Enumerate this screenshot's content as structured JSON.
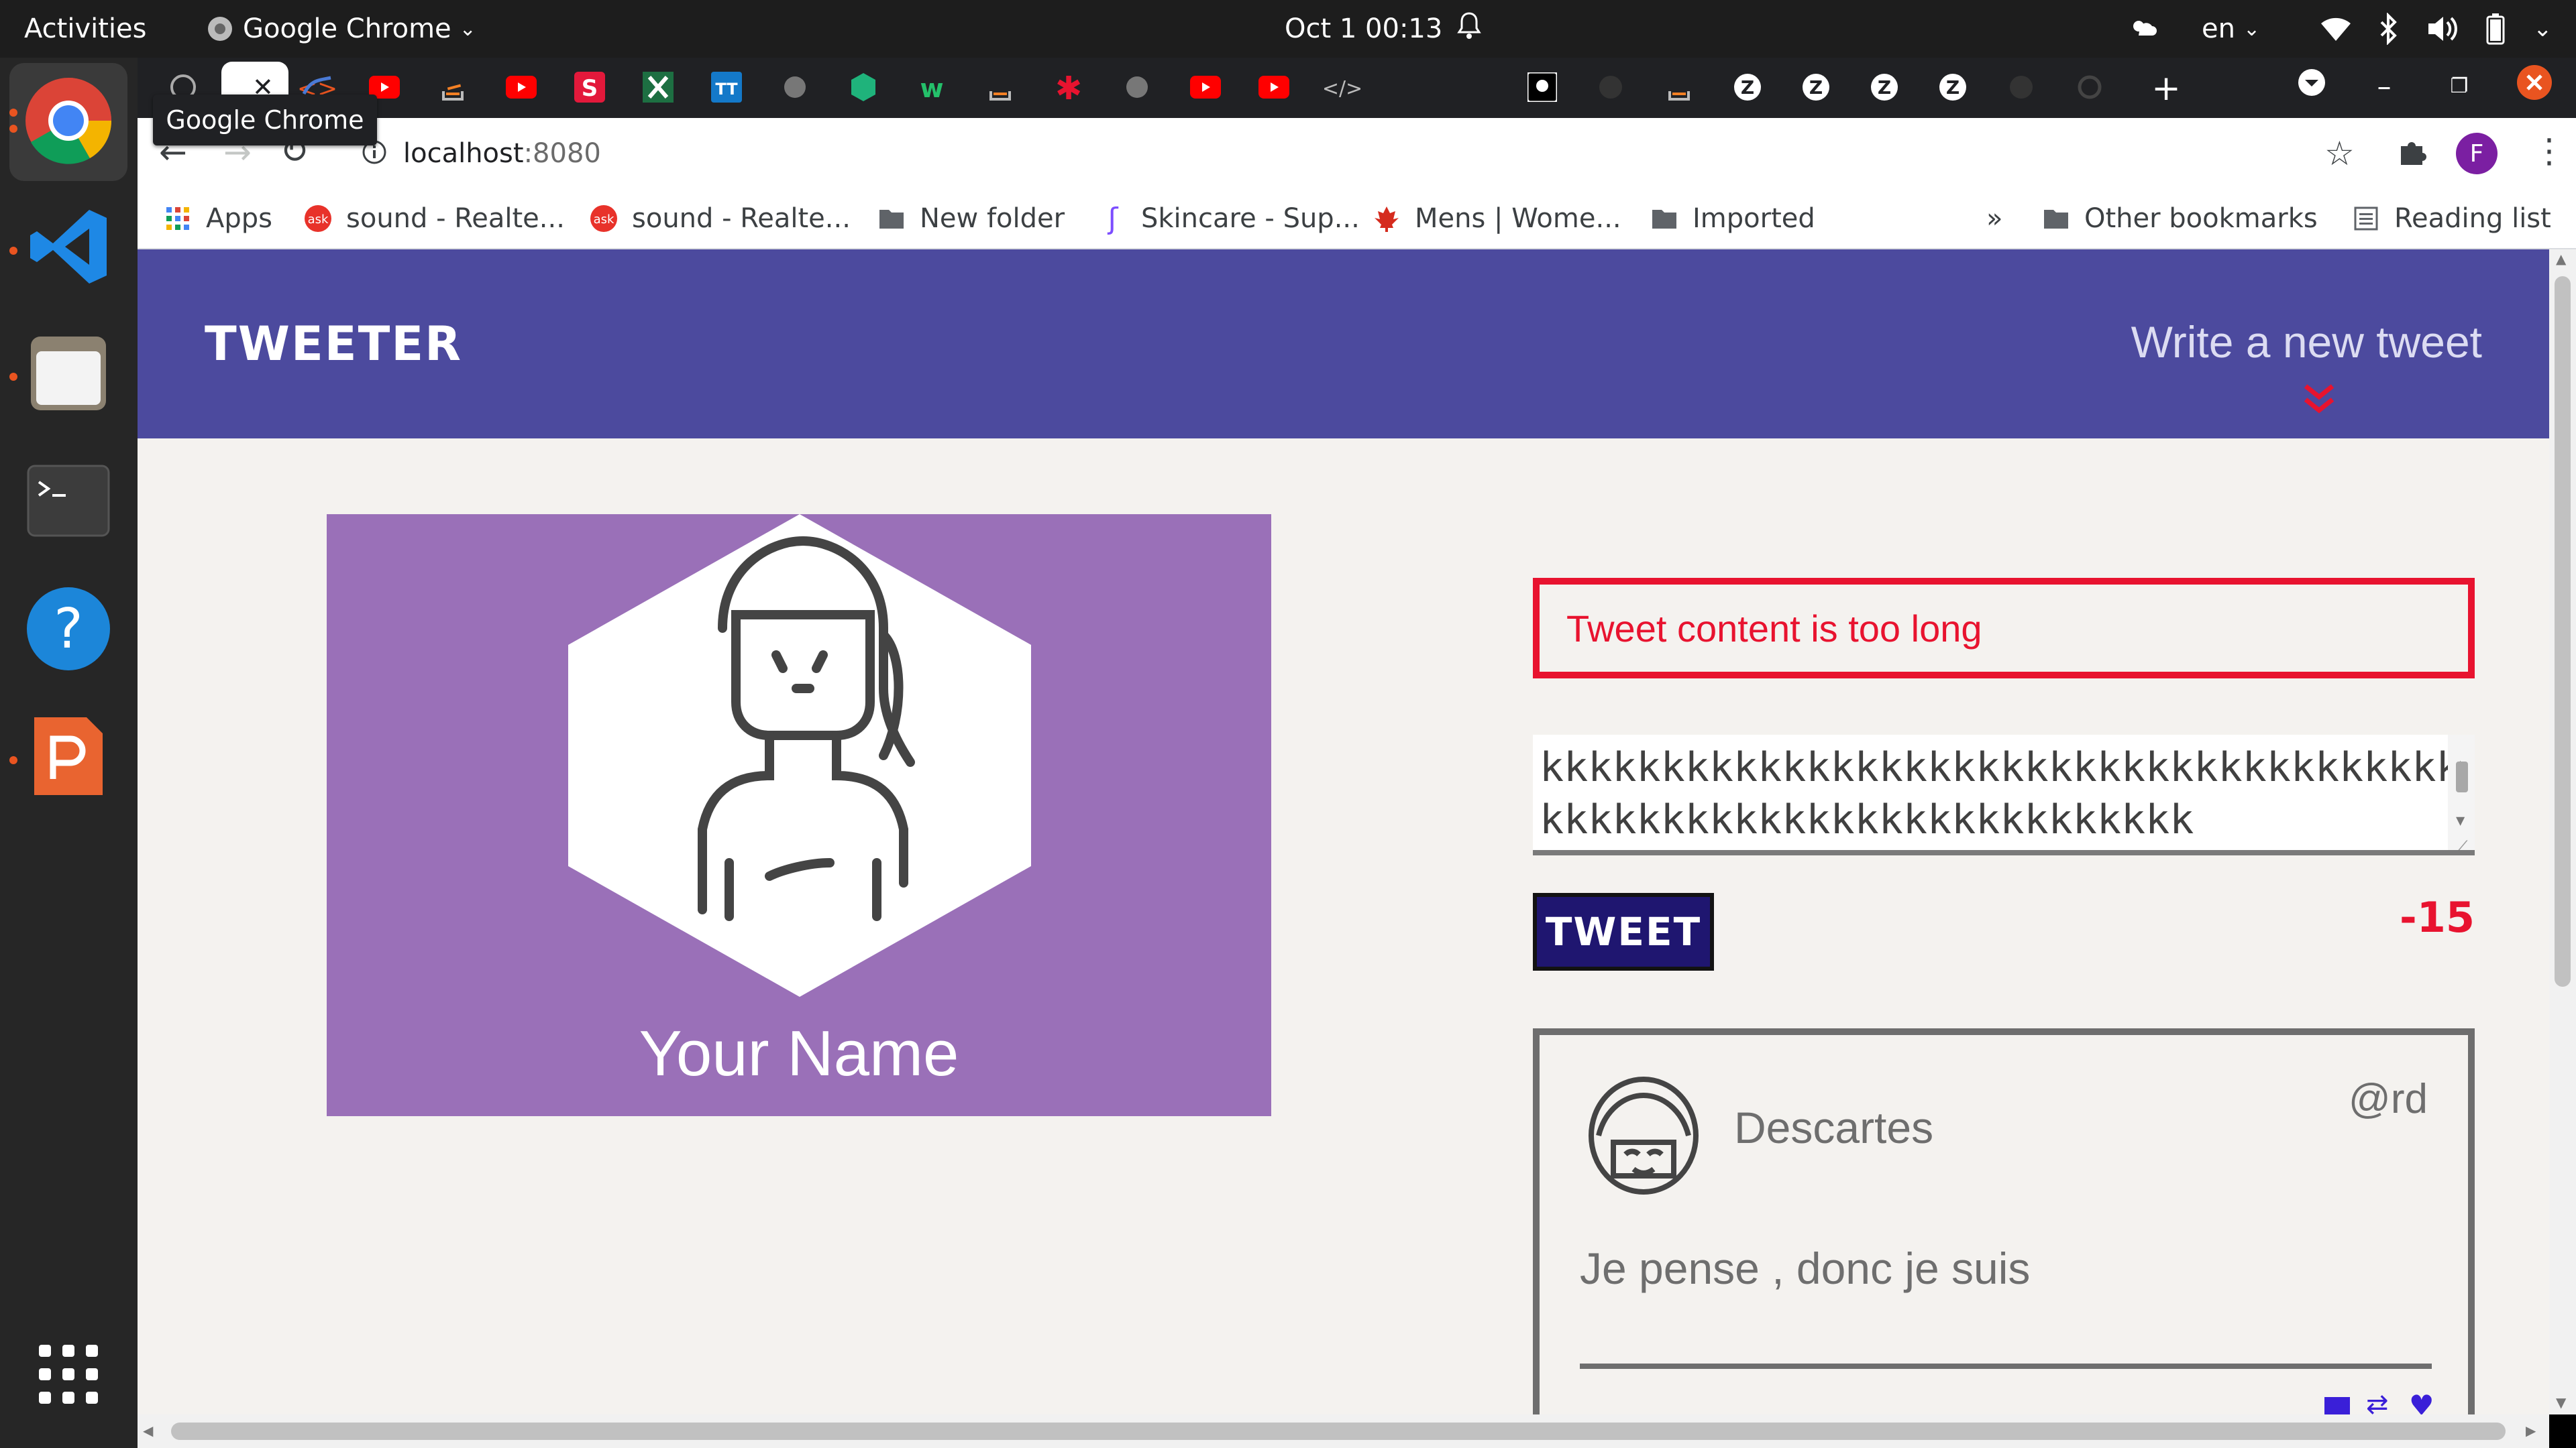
{
  "topbar": {
    "activities": "Activities",
    "app_name": "Google Chrome",
    "clock": "Oct 1  00:13",
    "keyboard_layout": "en"
  },
  "browser": {
    "tooltip": "Google Chrome",
    "address_host": "localhost",
    "address_port": ":8080",
    "profile_initial": "F",
    "bookmarks": [
      {
        "label": "Apps",
        "icon": "apps-grid-icon"
      },
      {
        "label": "sound - Realte...",
        "icon": "ask-icon"
      },
      {
        "label": "sound - Realte...",
        "icon": "ask-icon"
      },
      {
        "label": "New folder",
        "icon": "folder-icon"
      },
      {
        "label": "Skincare - Sup...",
        "icon": "skincare-icon"
      },
      {
        "label": "Mens | Wome...",
        "icon": "maple-leaf-icon"
      },
      {
        "label": "Imported",
        "icon": "folder-icon"
      }
    ],
    "overflow": "»",
    "other_bookmarks": "Other bookmarks",
    "reading_list": "Reading list"
  },
  "app": {
    "brand": "TWEETER",
    "write_new": "Write a new tweet",
    "profile_name": "Your Name",
    "error_message": "Tweet content is too long",
    "textarea_line1": "kkkkkkkkkkkkkkkkkkkkkkkkkkkkkkkkkkkkkkkkkkkk",
    "textarea_line2": "kkkkkkkkkkkkkkkkkkkkkkkkkkk",
    "tweet_button": "TWEET",
    "char_counter": "-15",
    "tweet": {
      "name": "Descartes",
      "handle": "@rd",
      "content": "Je pense , donc je suis"
    }
  },
  "colors": {
    "header": "#4c4a9e",
    "profile_bg": "#9a70b8",
    "error": "#e8132f",
    "tweet_button": "#1f1670"
  }
}
